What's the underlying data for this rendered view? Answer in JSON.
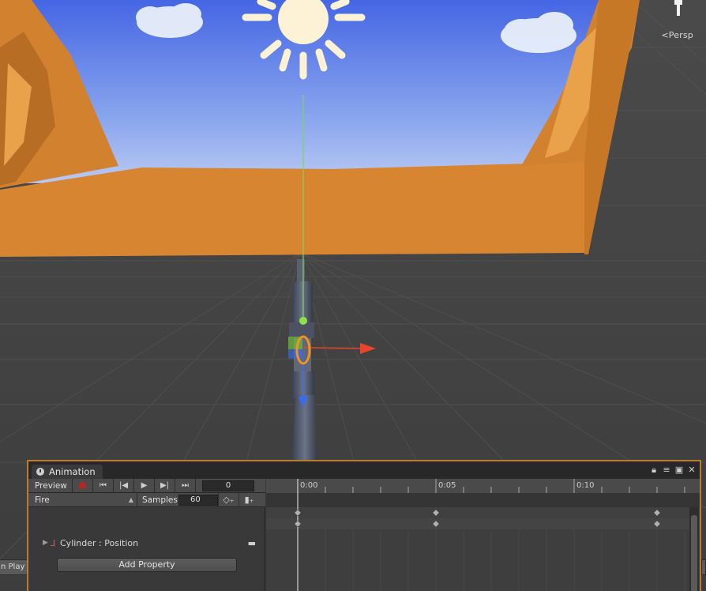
{
  "scene": {
    "camera_label": "Persp",
    "gizmo_icon": "light-gizmo-icon"
  },
  "left_stub": {
    "label": "n Play"
  },
  "animation_window": {
    "tab_title": "Animation",
    "tab_icon": "clock-icon",
    "window_controls": [
      "lock-icon",
      "menu-icon",
      "maximize-icon",
      "close-icon"
    ],
    "toolbar": {
      "preview_label": "Preview",
      "record_icon": "record-icon",
      "first_key_icon": "first-keyframe-icon",
      "prev_key_icon": "prev-keyframe-icon",
      "play_icon": "play-icon",
      "next_key_icon": "next-keyframe-icon",
      "last_key_icon": "last-keyframe-icon",
      "frame_value": "0"
    },
    "toolbar2": {
      "clip_name": "Fire",
      "samples_label": "Samples",
      "samples_value": "60",
      "add_keyframe_icon": "add-keyframe-icon",
      "add_event_icon": "add-event-icon"
    },
    "properties": [
      {
        "label": "Cylinder : Position",
        "icon": "transform-icon"
      }
    ],
    "add_property_label": "Add Property",
    "timeline": {
      "time_labels": [
        "0:00",
        "0:05",
        "0:10"
      ],
      "playhead_time": "0:00",
      "keyframe_times_seconds": [
        0,
        5,
        13
      ]
    }
  },
  "colors": {
    "accent_border": "#c07a2c",
    "record": "#b52626",
    "sky_top": "#4f6fe0",
    "terrain": "#d98a33"
  }
}
